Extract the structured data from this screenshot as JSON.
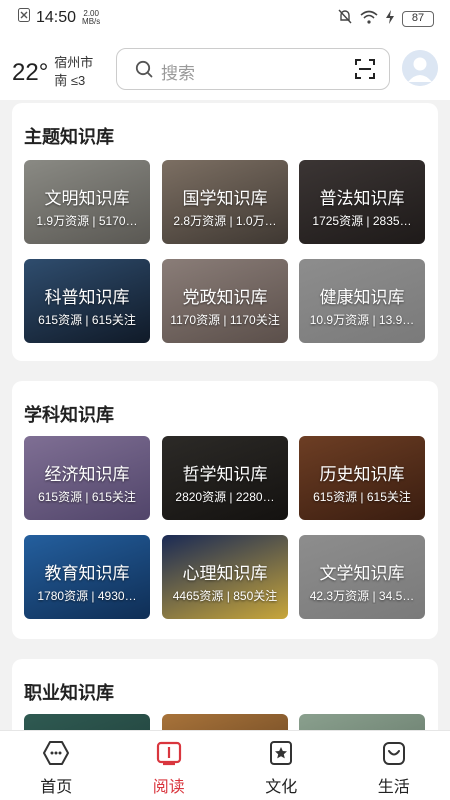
{
  "status_bar": {
    "time": "14:50",
    "speed_value": "2.00",
    "speed_unit": "MB/s",
    "battery": "87"
  },
  "header": {
    "temperature": "22°",
    "city": "宿州市",
    "wind": "南 ≤3",
    "search_placeholder": "搜索"
  },
  "sections": [
    {
      "title": "主题知识库",
      "cards": [
        {
          "title": "文明知识库",
          "sub": "1.9万资源 | 5170…",
          "colors": [
            "#8a8a84",
            "#5a5853"
          ]
        },
        {
          "title": "国学知识库",
          "sub": "2.8万资源 | 1.0万…",
          "colors": [
            "#7c6f63",
            "#3f3832"
          ]
        },
        {
          "title": "普法知识库",
          "sub": "1725资源 | 2835…",
          "colors": [
            "#3b3534",
            "#1e1a19"
          ]
        },
        {
          "title": "科普知识库",
          "sub": "615资源 | 615关注",
          "colors": [
            "#2f4d6e",
            "#101a28"
          ]
        },
        {
          "title": "党政知识库",
          "sub": "1170资源 | 1170关注",
          "colors": [
            "#8a7d78",
            "#5b4f4a"
          ]
        },
        {
          "title": "健康知识库",
          "sub": "10.9万资源 | 13.9…",
          "colors": [
            "#8d8d8d",
            "#7a7a7a"
          ]
        }
      ]
    },
    {
      "title": "学科知识库",
      "cards": [
        {
          "title": "经济知识库",
          "sub": "615资源 | 615关注",
          "colors": [
            "#7f6f94",
            "#51456a"
          ]
        },
        {
          "title": "哲学知识库",
          "sub": "2820资源 | 2280…",
          "colors": [
            "#2c2a27",
            "#141210"
          ]
        },
        {
          "title": "历史知识库",
          "sub": "615资源 | 615关注",
          "colors": [
            "#6d3e24",
            "#3a1d10"
          ]
        },
        {
          "title": "教育知识库",
          "sub": "1780资源 | 4930…",
          "colors": [
            "#245f9e",
            "#0f2e55"
          ]
        },
        {
          "title": "心理知识库",
          "sub": "4465资源 | 850关注",
          "colors": [
            "#1a2a55",
            "#c8a63a"
          ]
        },
        {
          "title": "文学知识库",
          "sub": "42.3万资源 | 34.5…",
          "colors": [
            "#8d8d8d",
            "#7a7a7a"
          ]
        }
      ]
    },
    {
      "title": "职业知识库",
      "cards": [
        {
          "colors": [
            "#2f5a52",
            "#1c3a35"
          ]
        },
        {
          "colors": [
            "#a8733a",
            "#5a3a1c"
          ]
        },
        {
          "colors": [
            "#8aa08e",
            "#5c6e60"
          ]
        }
      ]
    }
  ],
  "bottom_nav": [
    {
      "label": "首页",
      "icon": "home-icon"
    },
    {
      "label": "阅读",
      "icon": "book-icon",
      "active": true
    },
    {
      "label": "文化",
      "icon": "star-icon"
    },
    {
      "label": "生活",
      "icon": "smile-bag-icon"
    }
  ],
  "accent_color": "#d9363e"
}
